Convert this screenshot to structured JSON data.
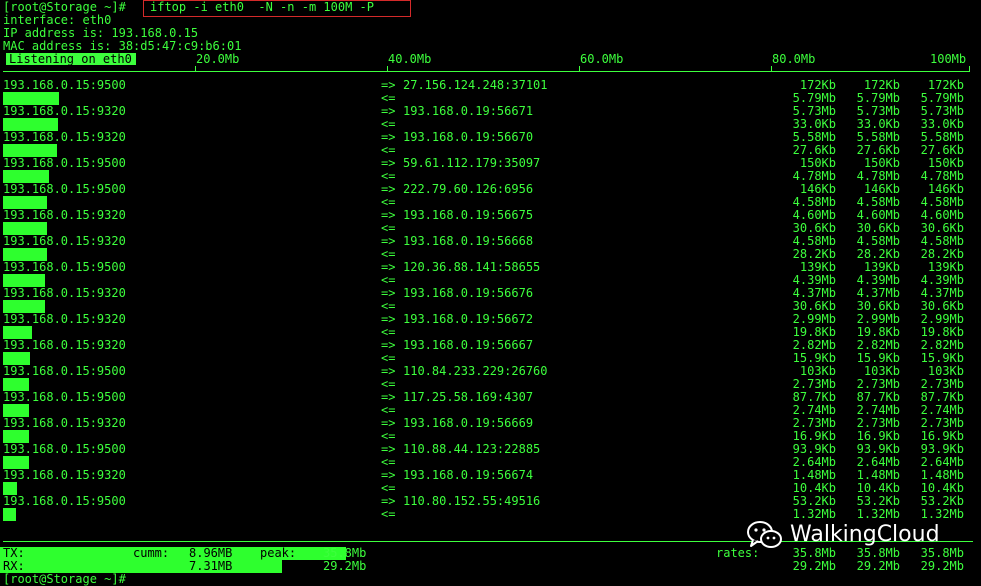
{
  "terminal": {
    "prompt": "[root@Storage ~]#",
    "command": "iftop -i eth0  -N -n -m 100M -P",
    "interface_line": "interface: eth0",
    "ip_line": "IP address is: 193.168.0.15",
    "mac_line": "MAC address is: 38:d5:47:c9:b6:01",
    "listening_label": "Listening on eth0",
    "last_prompt": "[root@Storage ~]#"
  },
  "scale": {
    "ticks": [
      "20.0Mb",
      "40.0Mb",
      "60.0Mb",
      "80.0Mb",
      "100Mb"
    ]
  },
  "connections": [
    {
      "src": "193.168.0.15:9500",
      "dst": "27.156.124.248:37101",
      "tx": [
        "172Kb",
        "172Kb",
        "172Kb"
      ],
      "rx": [
        "5.79Mb",
        "5.79Mb",
        "5.79Mb"
      ],
      "bar_fraction": 0.0579
    },
    {
      "src": "193.168.0.15:9320",
      "dst": "193.168.0.19:56671",
      "tx": [
        "5.73Mb",
        "5.73Mb",
        "5.73Mb"
      ],
      "rx": [
        "33.0Kb",
        "33.0Kb",
        "33.0Kb"
      ],
      "bar_fraction": 0.0573
    },
    {
      "src": "193.168.0.15:9320",
      "dst": "193.168.0.19:56670",
      "tx": [
        "5.58Mb",
        "5.58Mb",
        "5.58Mb"
      ],
      "rx": [
        "27.6Kb",
        "27.6Kb",
        "27.6Kb"
      ],
      "bar_fraction": 0.0558
    },
    {
      "src": "193.168.0.15:9500",
      "dst": "59.61.112.179:35097",
      "tx": [
        "150Kb",
        "150Kb",
        "150Kb"
      ],
      "rx": [
        "4.78Mb",
        "4.78Mb",
        "4.78Mb"
      ],
      "bar_fraction": 0.0478
    },
    {
      "src": "193.168.0.15:9500",
      "dst": "222.79.60.126:6956",
      "tx": [
        "146Kb",
        "146Kb",
        "146Kb"
      ],
      "rx": [
        "4.58Mb",
        "4.58Mb",
        "4.58Mb"
      ],
      "bar_fraction": 0.0458
    },
    {
      "src": "193.168.0.15:9320",
      "dst": "193.168.0.19:56675",
      "tx": [
        "4.60Mb",
        "4.60Mb",
        "4.60Mb"
      ],
      "rx": [
        "30.6Kb",
        "30.6Kb",
        "30.6Kb"
      ],
      "bar_fraction": 0.046
    },
    {
      "src": "193.168.0.15:9320",
      "dst": "193.168.0.19:56668",
      "tx": [
        "4.58Mb",
        "4.58Mb",
        "4.58Mb"
      ],
      "rx": [
        "28.2Kb",
        "28.2Kb",
        "28.2Kb"
      ],
      "bar_fraction": 0.0458
    },
    {
      "src": "193.168.0.15:9500",
      "dst": "120.36.88.141:58655",
      "tx": [
        "139Kb",
        "139Kb",
        "139Kb"
      ],
      "rx": [
        "4.39Mb",
        "4.39Mb",
        "4.39Mb"
      ],
      "bar_fraction": 0.0439
    },
    {
      "src": "193.168.0.15:9320",
      "dst": "193.168.0.19:56676",
      "tx": [
        "4.37Mb",
        "4.37Mb",
        "4.37Mb"
      ],
      "rx": [
        "30.6Kb",
        "30.6Kb",
        "30.6Kb"
      ],
      "bar_fraction": 0.0437
    },
    {
      "src": "193.168.0.15:9320",
      "dst": "193.168.0.19:56672",
      "tx": [
        "2.99Mb",
        "2.99Mb",
        "2.99Mb"
      ],
      "rx": [
        "19.8Kb",
        "19.8Kb",
        "19.8Kb"
      ],
      "bar_fraction": 0.0299
    },
    {
      "src": "193.168.0.15:9320",
      "dst": "193.168.0.19:56667",
      "tx": [
        "2.82Mb",
        "2.82Mb",
        "2.82Mb"
      ],
      "rx": [
        "15.9Kb",
        "15.9Kb",
        "15.9Kb"
      ],
      "bar_fraction": 0.0282
    },
    {
      "src": "193.168.0.15:9500",
      "dst": "110.84.233.229:26760",
      "tx": [
        "103Kb",
        "103Kb",
        "103Kb"
      ],
      "rx": [
        "2.73Mb",
        "2.73Mb",
        "2.73Mb"
      ],
      "bar_fraction": 0.0273
    },
    {
      "src": "193.168.0.15:9500",
      "dst": "117.25.58.169:4307",
      "tx": [
        "87.7Kb",
        "87.7Kb",
        "87.7Kb"
      ],
      "rx": [
        "2.74Mb",
        "2.74Mb",
        "2.74Mb"
      ],
      "bar_fraction": 0.0274
    },
    {
      "src": "193.168.0.15:9320",
      "dst": "193.168.0.19:56669",
      "tx": [
        "2.73Mb",
        "2.73Mb",
        "2.73Mb"
      ],
      "rx": [
        "16.9Kb",
        "16.9Kb",
        "16.9Kb"
      ],
      "bar_fraction": 0.0273
    },
    {
      "src": "193.168.0.15:9500",
      "dst": "110.88.44.123:22885",
      "tx": [
        "93.9Kb",
        "93.9Kb",
        "93.9Kb"
      ],
      "rx": [
        "2.64Mb",
        "2.64Mb",
        "2.64Mb"
      ],
      "bar_fraction": 0.0264
    },
    {
      "src": "193.168.0.15:9320",
      "dst": "193.168.0.19:56674",
      "tx": [
        "1.48Mb",
        "1.48Mb",
        "1.48Mb"
      ],
      "rx": [
        "10.4Kb",
        "10.4Kb",
        "10.4Kb"
      ],
      "bar_fraction": 0.0148
    },
    {
      "src": "193.168.0.15:9500",
      "dst": "110.80.152.55:49516",
      "tx": [
        "53.2Kb",
        "53.2Kb",
        "53.2Kb"
      ],
      "rx": [
        "1.32Mb",
        "1.32Mb",
        "1.32Mb"
      ],
      "bar_fraction": 0.0132
    }
  ],
  "arrows": {
    "out": "=>",
    "in": "<="
  },
  "totals": {
    "tx_label": "TX:",
    "rx_label": "RX:",
    "cumm_label": "cumm:",
    "peak_label": "peak:",
    "rates_label": "rates:",
    "tx_cumm": "8.96MB",
    "rx_cumm": "7.31MB",
    "tx_peak": "35.8Mb",
    "rx_peak": "29.2Mb",
    "tx_rates": [
      "35.8Mb",
      "35.8Mb",
      "35.8Mb"
    ],
    "rx_rates": [
      "29.2Mb",
      "29.2Mb",
      "29.2Mb"
    ],
    "tx_bar_fraction": 0.358,
    "rx_bar_fraction": 0.292
  },
  "watermark": {
    "text": "WalkingCloud",
    "icon": "wechat-logo-icon"
  },
  "colors": {
    "background": "#000000",
    "foreground": "#3dff3d",
    "bar": "#2eff2e",
    "command_box": "#d42a2a"
  }
}
